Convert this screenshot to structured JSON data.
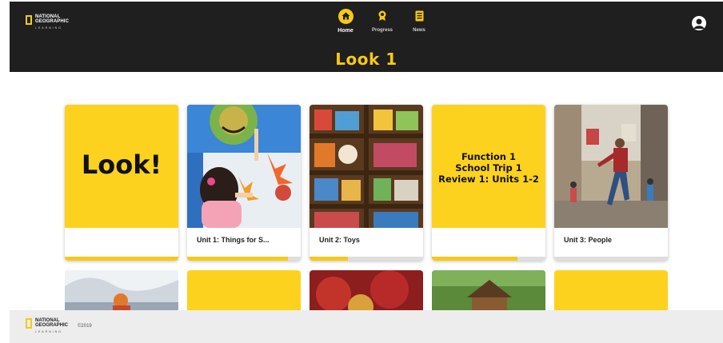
{
  "brand": {
    "line1": "NATIONAL",
    "line2": "GEOGRAPHIC",
    "line3": "LEARNING"
  },
  "nav": {
    "items": [
      {
        "label": "Home",
        "icon": "home-icon",
        "active": true
      },
      {
        "label": "Progress",
        "icon": "award-icon",
        "active": false
      },
      {
        "label": "News",
        "icon": "news-icon",
        "active": false
      }
    ]
  },
  "page": {
    "title": "Look 1"
  },
  "cards": [
    {
      "cover_text": "Look!",
      "label": "",
      "progress": 1.0
    },
    {
      "label": "Unit 1: Things for S...",
      "progress": 0.89
    },
    {
      "label": "Unit 2: Toys",
      "progress": 0.34
    },
    {
      "cover_lines": [
        "Function 1",
        "School Trip 1",
        "Review 1: Units 1-2"
      ],
      "label": "",
      "progress": 0.75
    },
    {
      "label": "Unit 3: People",
      "progress": 0.0
    }
  ],
  "footer": {
    "copyright": "©2019"
  },
  "colors": {
    "accent": "#fdd21e",
    "dark": "#1f1f1f",
    "footer_bg": "#ededed"
  }
}
